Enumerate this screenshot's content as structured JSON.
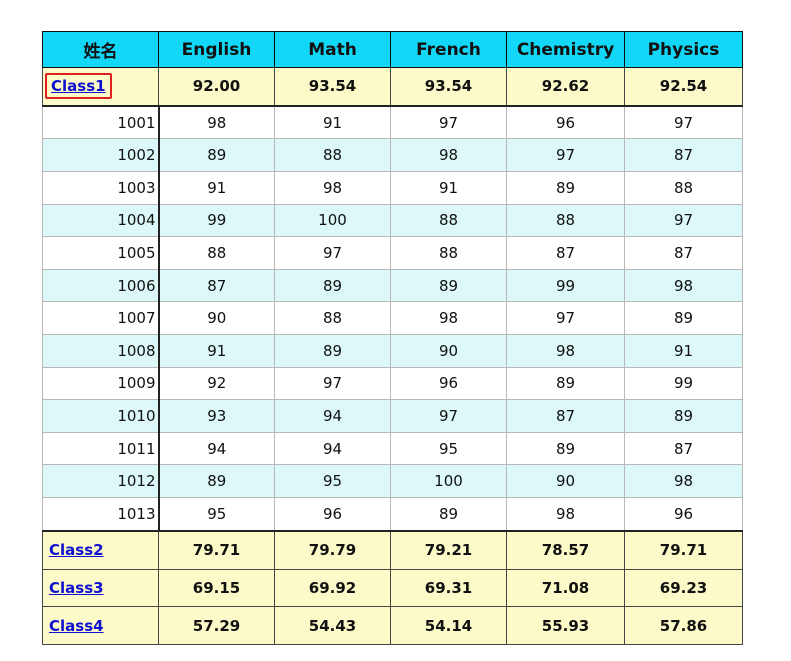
{
  "table": {
    "headers": [
      "姓名",
      "English",
      "Math",
      "French",
      "Chemistry",
      "Physics"
    ],
    "first_class": {
      "name": "Class1",
      "averages": [
        "92.00",
        "93.54",
        "93.54",
        "92.62",
        "92.54"
      ]
    },
    "students": [
      {
        "id": "1001",
        "scores": [
          "98",
          "91",
          "97",
          "96",
          "97"
        ]
      },
      {
        "id": "1002",
        "scores": [
          "89",
          "88",
          "98",
          "97",
          "87"
        ]
      },
      {
        "id": "1003",
        "scores": [
          "91",
          "98",
          "91",
          "89",
          "88"
        ]
      },
      {
        "id": "1004",
        "scores": [
          "99",
          "100",
          "88",
          "88",
          "97"
        ]
      },
      {
        "id": "1005",
        "scores": [
          "88",
          "97",
          "88",
          "87",
          "87"
        ]
      },
      {
        "id": "1006",
        "scores": [
          "87",
          "89",
          "89",
          "99",
          "98"
        ]
      },
      {
        "id": "1007",
        "scores": [
          "90",
          "88",
          "98",
          "97",
          "89"
        ]
      },
      {
        "id": "1008",
        "scores": [
          "91",
          "89",
          "90",
          "98",
          "91"
        ]
      },
      {
        "id": "1009",
        "scores": [
          "92",
          "97",
          "96",
          "89",
          "99"
        ]
      },
      {
        "id": "1010",
        "scores": [
          "93",
          "94",
          "97",
          "87",
          "89"
        ]
      },
      {
        "id": "1011",
        "scores": [
          "94",
          "94",
          "95",
          "89",
          "87"
        ]
      },
      {
        "id": "1012",
        "scores": [
          "89",
          "95",
          "100",
          "90",
          "98"
        ]
      },
      {
        "id": "1013",
        "scores": [
          "95",
          "96",
          "89",
          "98",
          "96"
        ]
      }
    ],
    "other_classes": [
      {
        "name": "Class2",
        "averages": [
          "79.71",
          "79.79",
          "79.21",
          "78.57",
          "79.71"
        ]
      },
      {
        "name": "Class3",
        "averages": [
          "69.15",
          "69.92",
          "69.31",
          "71.08",
          "69.23"
        ]
      },
      {
        "name": "Class4",
        "averages": [
          "57.29",
          "54.43",
          "54.14",
          "55.93",
          "57.86"
        ]
      }
    ]
  },
  "colors": {
    "header_bg": "#12d7f7",
    "summary_bg": "#fcfac8",
    "alt_row_bg": "#dcf8f8",
    "link": "#1010d0",
    "highlight_box": "#e02020"
  }
}
